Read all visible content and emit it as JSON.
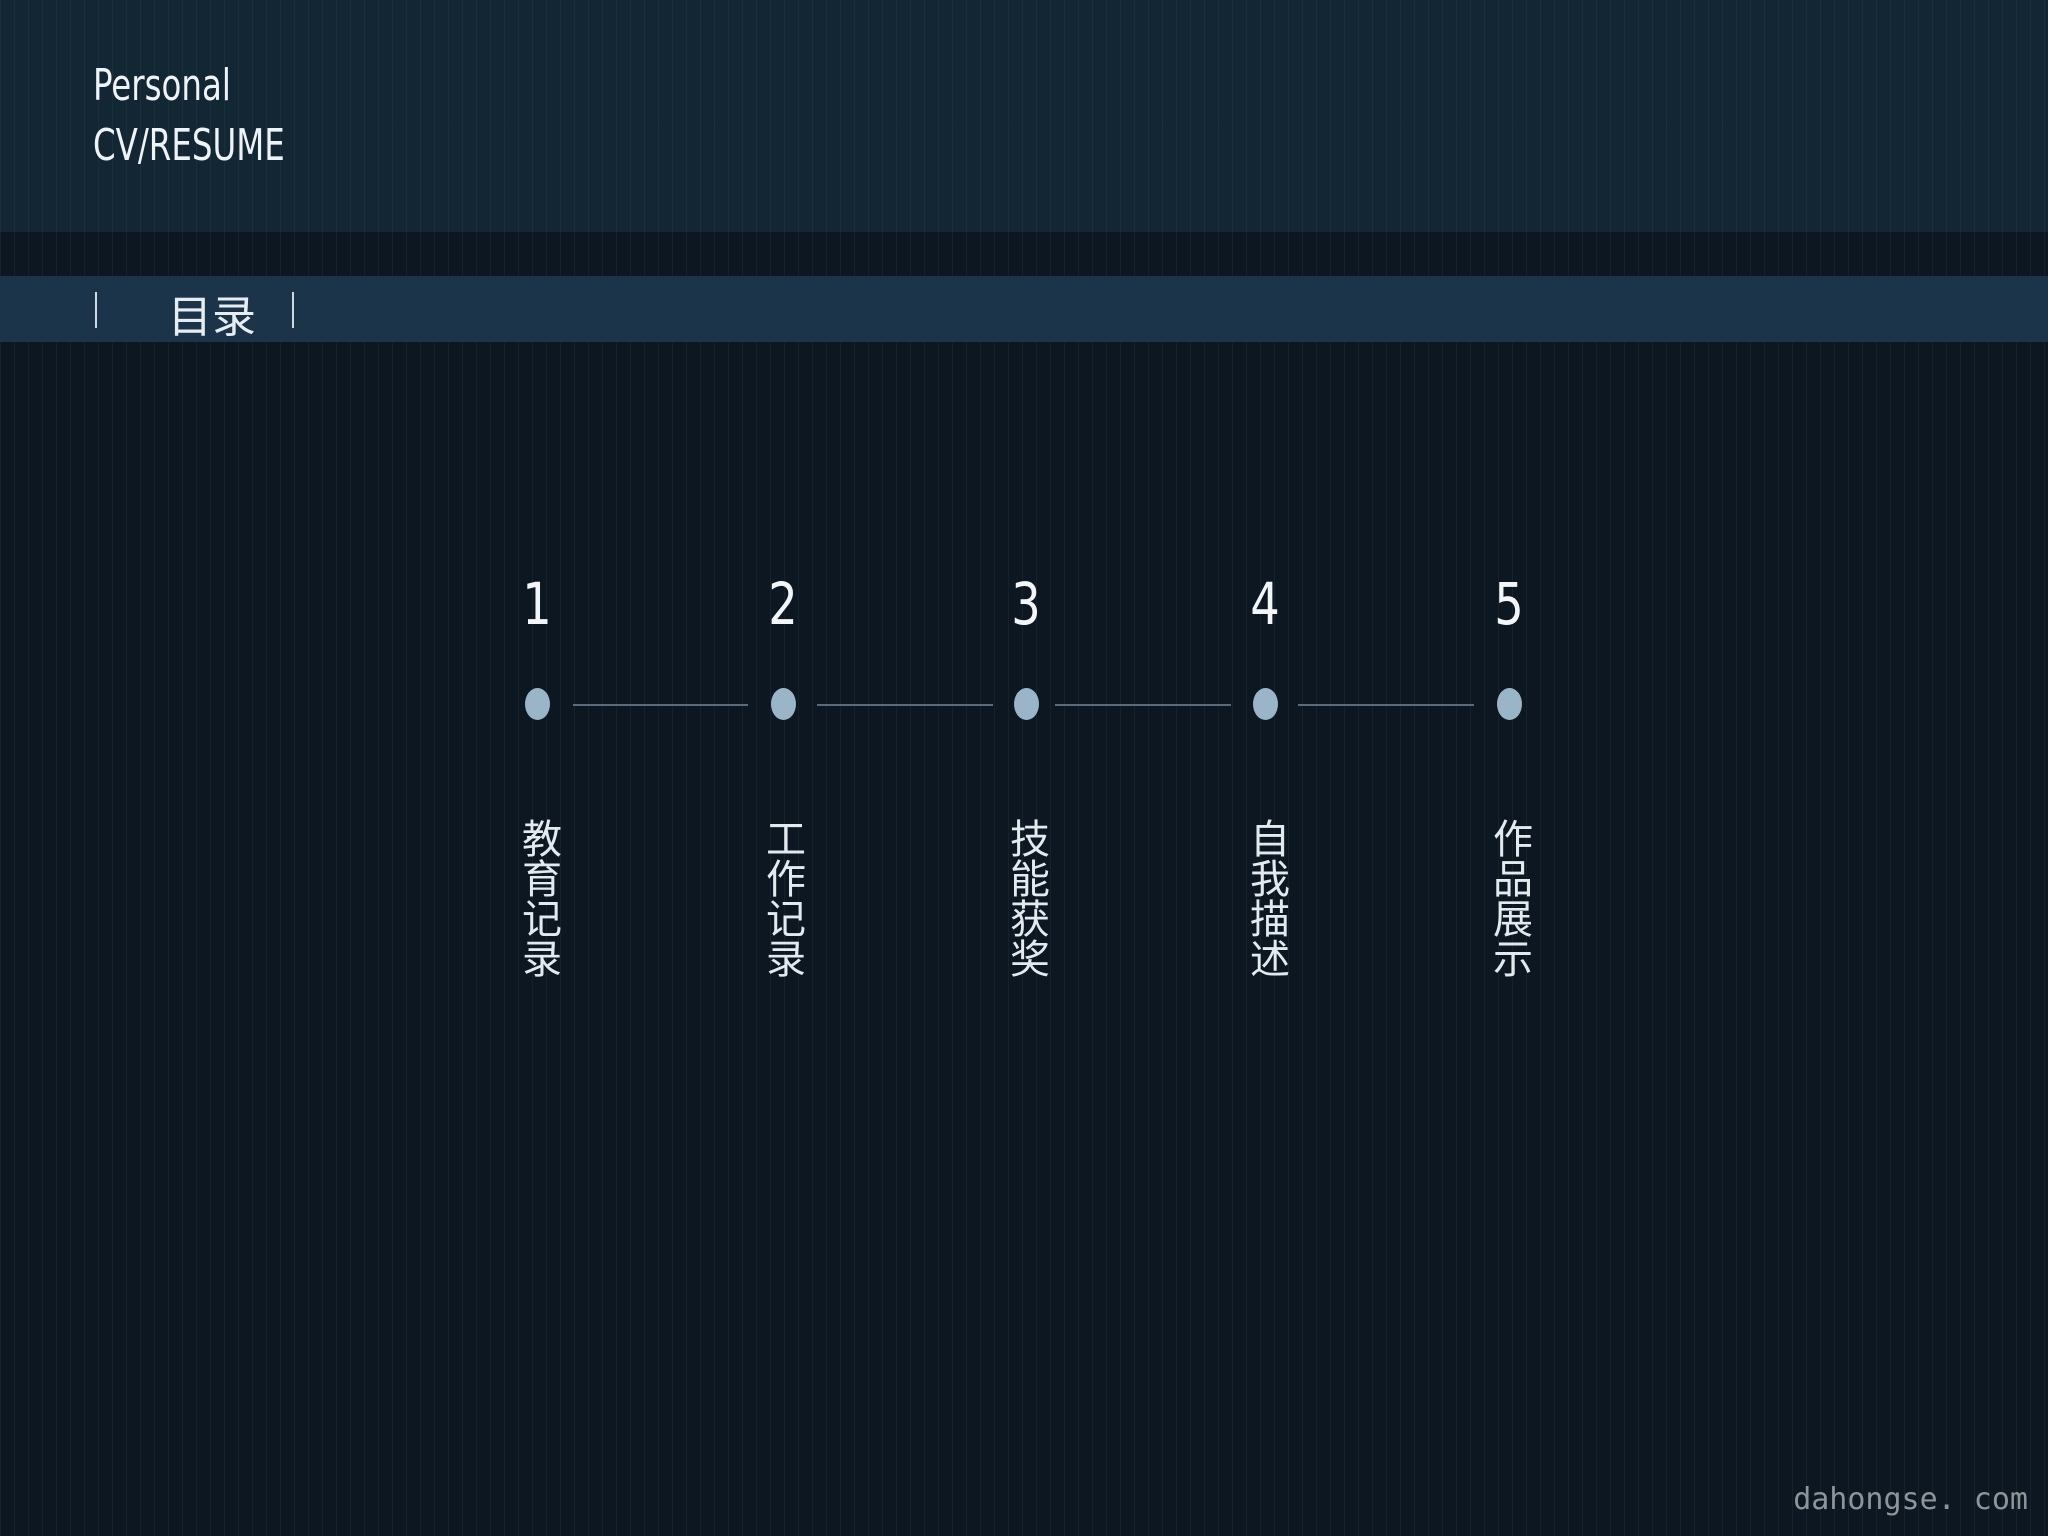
{
  "header": {
    "title_line1": "Personal",
    "title_line2": "CV/RESUME"
  },
  "nav": {
    "label": "目录"
  },
  "timeline": {
    "steps": [
      {
        "number": "1",
        "label": "教育记录"
      },
      {
        "number": "2",
        "label": "工作记录"
      },
      {
        "number": "3",
        "label": "技能获奖"
      },
      {
        "number": "4",
        "label": "自我描述"
      },
      {
        "number": "5",
        "label": "作品展示"
      }
    ]
  },
  "footer": {
    "watermark": "dahongse. com"
  },
  "colors": {
    "background": "#0c1721",
    "header_band": "#132634",
    "nav_band": "#1b3449",
    "dot": "#9ab5c8",
    "connector": "#596c7b",
    "text": "#eef3f7",
    "watermark": "#8d959b"
  }
}
